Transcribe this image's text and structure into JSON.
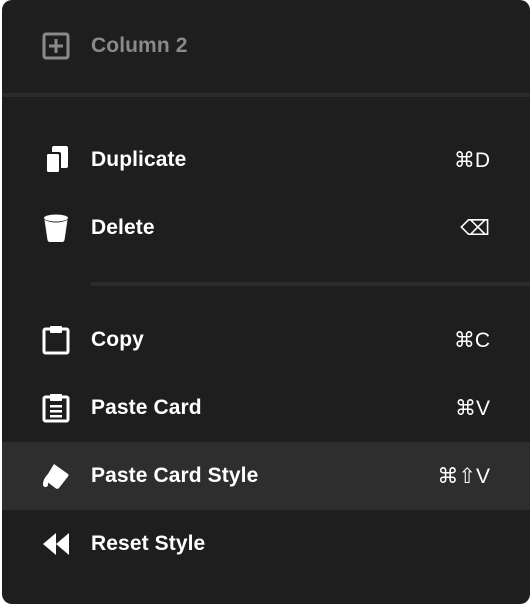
{
  "menu": {
    "header": {
      "label": "Column 2",
      "icon": "plus-square-icon"
    },
    "items": [
      {
        "label": "Duplicate",
        "shortcut": "⌘D",
        "icon": "duplicate-icon"
      },
      {
        "label": "Delete",
        "shortcut": "⌫",
        "icon": "trash-icon"
      },
      {
        "label": "Copy",
        "shortcut": "⌘C",
        "icon": "clipboard-icon"
      },
      {
        "label": "Paste Card",
        "shortcut": "⌘V",
        "icon": "clipboard-list-icon"
      },
      {
        "label": "Paste Card Style",
        "shortcut": "⌘⇧V",
        "icon": "paint-bucket-icon",
        "highlighted": true
      },
      {
        "label": "Reset Style",
        "shortcut": "",
        "icon": "rewind-icon"
      }
    ]
  },
  "colors": {
    "menu_background": "#1e1e1e",
    "highlight_background": "#2e2e2e",
    "separator": "#2b2b2b",
    "disabled_text": "#8a8a8a",
    "text": "#ffffff"
  }
}
